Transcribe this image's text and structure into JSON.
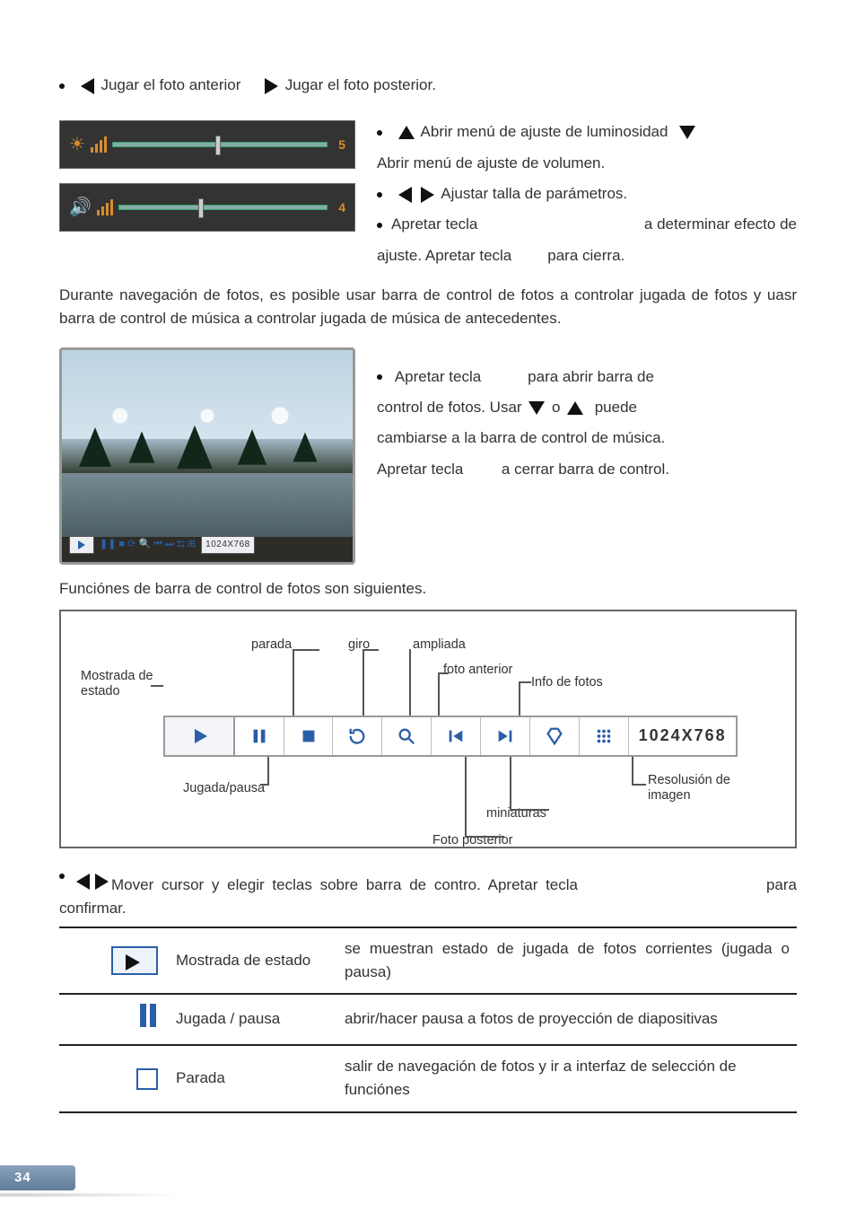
{
  "top_line": {
    "prev": "Jugar el foto anterior",
    "next": "Jugar el foto posterior."
  },
  "sliders": {
    "brightness_value": "5",
    "volume_value": "4"
  },
  "right_block": {
    "l1_open_brightness": "Abrir menú de ajuste de luminosidad",
    "l2_open_volume": "Abrir menú de ajuste de volumen.",
    "l3_adjust": "Ajustar talla de parámetros.",
    "l4_a": "Apretar tecla",
    "l4_b": "a determinar efecto de",
    "l5_a": "ajuste. Apretar tecla",
    "l5_b": "para cierra."
  },
  "para_nav": "Durante navegación de fotos, es posible usar barra de control de fotos a controlar jugada de fotos y uasr barra de control de música a controlar jugada de música de antecedentes.",
  "photo_bar_res": "1024X768",
  "photo_right": {
    "p1_a": "Apretar tecla",
    "p1_b": "para abrir barra de",
    "p2_a": "control de fotos. Usar",
    "p2_b": "o",
    "p2_c": "puede",
    "p3": "cambiarse a la barra de control de música.",
    "p4_a": "Apretar tecla",
    "p4_b": "a cerrar barra de control."
  },
  "subhead_functions": "Funciónes de barra de control de fotos son siguientes.",
  "diagram": {
    "mostrada": "Mostrada de estado",
    "parada": "parada",
    "giro": "giro",
    "ampliada": "ampliada",
    "foto_anterior": "foto anterior",
    "info": "Info de fotos",
    "jugada_pausa": "Jugada/pausa",
    "miniaturas": "miniaturas",
    "foto_posterior": "Foto posterior",
    "resolucion": "Resolusión de imagen",
    "toolbar_res": "1024X768"
  },
  "lower_line": {
    "a": "Mover cursor y elegir teclas sobre barra de contro. Apretar tecla",
    "b": "para",
    "c": "confirmar."
  },
  "table": {
    "r1_name": "Mostrada de estado",
    "r1_desc": "se muestran estado de jugada de fotos corrientes (jugada o pausa)",
    "r2_name": "Jugada / pausa",
    "r2_desc": "abrir/hacer pausa a fotos de proyección de diapositivas",
    "r3_name": "Parada",
    "r3_desc": "salir de navegación de fotos y ir a interfaz de selección de funciónes"
  },
  "page_number": "34"
}
